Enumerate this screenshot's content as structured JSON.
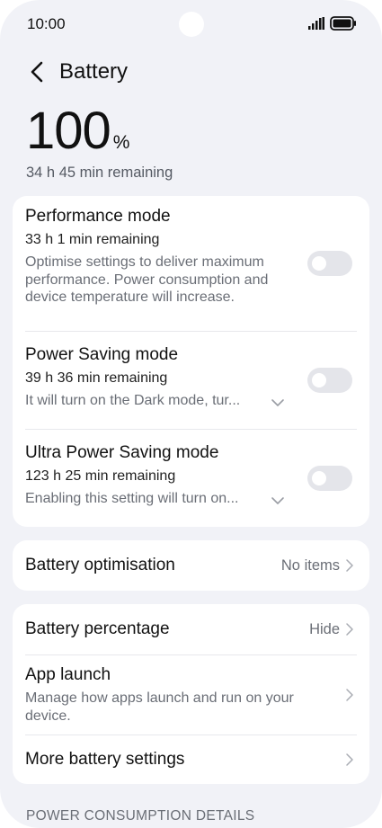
{
  "status_bar": {
    "time": "10:00",
    "icons": [
      "signal-icon",
      "battery-icon"
    ]
  },
  "header": {
    "title": "Battery",
    "back_icon": "chevron-left-icon"
  },
  "battery": {
    "level": "100",
    "unit": "%",
    "remaining": "34 h 45 min remaining"
  },
  "modes": [
    {
      "title": "Performance mode",
      "remaining": "33 h 1 min remaining",
      "description": "Optimise settings to deliver maximum performance. Power consumption and device temperature will increase.",
      "enabled": false
    },
    {
      "title": "Power Saving mode",
      "remaining": "39 h 36 min remaining",
      "description": "It will turn on the Dark mode, tur...",
      "enabled": false
    },
    {
      "title": "Ultra Power Saving mode",
      "remaining": "123 h 25 min remaining",
      "description": "Enabling this setting will turn on...",
      "enabled": false
    }
  ],
  "optimisation": {
    "label": "Battery optimisation",
    "value": "No items"
  },
  "settings": {
    "battery_percentage": {
      "label": "Battery percentage",
      "value": "Hide"
    },
    "app_launch": {
      "label": "App launch",
      "description": "Manage how apps launch and run on your device."
    },
    "more": {
      "label": "More battery settings"
    }
  },
  "section_header": "POWER CONSUMPTION DETAILS",
  "colors": {
    "background": "#f1f2f7",
    "card": "#ffffff",
    "toggle_off": "#e4e5ea",
    "secondary_text": "#6a6e76"
  }
}
